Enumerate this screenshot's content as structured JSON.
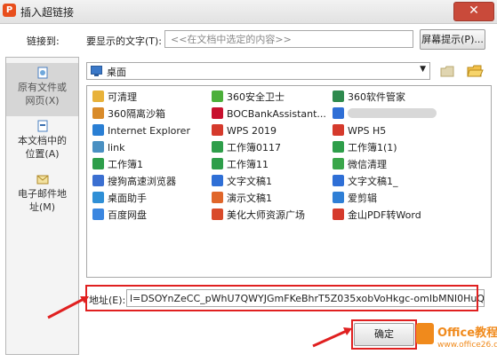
{
  "window": {
    "title": "插入超链接",
    "close_glyph": "✕"
  },
  "link_to_label": "链接到:",
  "display_text": {
    "label": "要显示的文字(T):",
    "placeholder": "<<在文档中选定的内容>>"
  },
  "screen_tip_button": "屏幕提示(P)...",
  "nav": [
    {
      "label": "原有文件或网页(X)",
      "icon": "globe-document-icon",
      "active": true
    },
    {
      "label": "本文档中的位置(A)",
      "icon": "document-position-icon",
      "active": false
    },
    {
      "label": "电子邮件地址(M)",
      "icon": "email-icon",
      "active": false
    }
  ],
  "folder": {
    "current": "桌面"
  },
  "files": [
    {
      "name": "可清理",
      "icon": "folder-icon",
      "color": "#e8b23a"
    },
    {
      "name": "360隔离沙箱",
      "icon": "sandbox-icon",
      "color": "#d98b2a"
    },
    {
      "name": "Internet Explorer",
      "icon": "ie-icon",
      "color": "#2a7fd4"
    },
    {
      "name": "link",
      "icon": "link-icon",
      "color": "#4a90c2"
    },
    {
      "name": "工作簿1",
      "icon": "spreadsheet-icon",
      "color": "#2e9e4a"
    },
    {
      "name": "搜狗高速浏览器",
      "icon": "sogou-browser-icon",
      "color": "#3b6fd1"
    },
    {
      "name": "桌面助手",
      "icon": "desktop-assistant-icon",
      "color": "#2f8fd6"
    },
    {
      "name": "百度网盘",
      "icon": "baidu-netdisk-icon",
      "color": "#3a86e0"
    },
    {
      "name": "360安全卫士",
      "icon": "360-security-icon",
      "color": "#4caf3a"
    },
    {
      "name": "BOCBankAssistant...",
      "icon": "boc-icon",
      "color": "#c8102e"
    },
    {
      "name": "WPS 2019",
      "icon": "wps-icon",
      "color": "#d53a2c"
    },
    {
      "name": "工作簿0117",
      "icon": "spreadsheet-icon",
      "color": "#2e9e4a"
    },
    {
      "name": "工作簿11",
      "icon": "spreadsheet-icon",
      "color": "#2e9e4a"
    },
    {
      "name": "文字文稿1",
      "icon": "document-icon",
      "color": "#2f6fd6"
    },
    {
      "name": "演示文稿1",
      "icon": "presentation-icon",
      "color": "#e0662a"
    },
    {
      "name": "美化大师资源广场",
      "icon": "beautify-icon",
      "color": "#d94a2a"
    },
    {
      "name": "360软件管家",
      "icon": "360-software-icon",
      "color": "#2e8a4e"
    },
    {
      "name": "",
      "icon": "document-icon",
      "color": "#2f6fd6"
    },
    {
      "name": "WPS H5",
      "icon": "wps-h5-icon",
      "color": "#d53a2c"
    },
    {
      "name": "工作簿1(1)",
      "icon": "spreadsheet-icon",
      "color": "#2e9e4a"
    },
    {
      "name": "微信清理",
      "icon": "wechat-clean-icon",
      "color": "#3aa64a"
    },
    {
      "name": "文字文稿1_",
      "icon": "document-icon",
      "color": "#2f6fd6"
    },
    {
      "name": "爱剪辑",
      "icon": "video-editor-icon",
      "color": "#2f7fd6"
    },
    {
      "name": "金山PDF转Word",
      "icon": "pdf-convert-icon",
      "color": "#d53a2c"
    }
  ],
  "address": {
    "label": "地址(E):",
    "value": "l=DSOYnZeCC_pWhU7QWYJGmFKeBhrT5Z035xobVoHkgc-omIbMNI0HuQ..."
  },
  "ok_button": "确定",
  "watermark": {
    "text": "Office教程网",
    "url": "www.office26.com"
  },
  "colors": {
    "accent_red": "#e02020",
    "watermark_orange": "#f08a1c"
  }
}
